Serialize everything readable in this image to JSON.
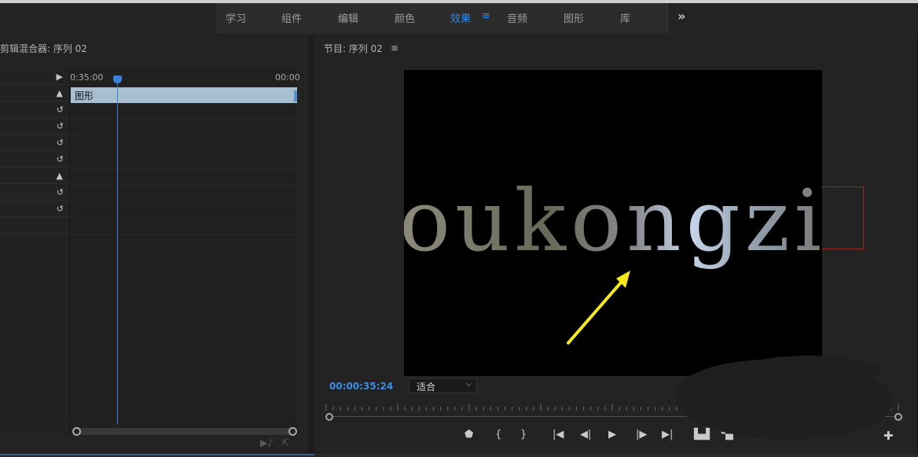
{
  "workspace_tabs": [
    {
      "label": "学习"
    },
    {
      "label": "组件"
    },
    {
      "label": "编辑"
    },
    {
      "label": "颜色"
    },
    {
      "label": "效果",
      "active": true
    },
    {
      "label": "音频"
    },
    {
      "label": "图形"
    },
    {
      "label": "库"
    }
  ],
  "workspace_menu_icon": "≡",
  "workspace_more": "»",
  "left_panel": {
    "title": "剪辑混合器: 序列 02",
    "timeline_start": "0:35:00",
    "timeline_end": "00:00",
    "clip_label": "图形"
  },
  "program": {
    "title": "节目: 序列 02",
    "menu_icon": "≡",
    "timecode": "00:00:35:24",
    "zoom": "适合",
    "video_text": "oukongzi"
  },
  "transport_controls": [
    "marker",
    "mark-in",
    "mark-out",
    "go-to-in",
    "step-back",
    "play",
    "step-forward",
    "go-to-out",
    "insert",
    "overwrite",
    "lift",
    "export-frame",
    "add-button"
  ],
  "accent_color": "#2d8ceb"
}
